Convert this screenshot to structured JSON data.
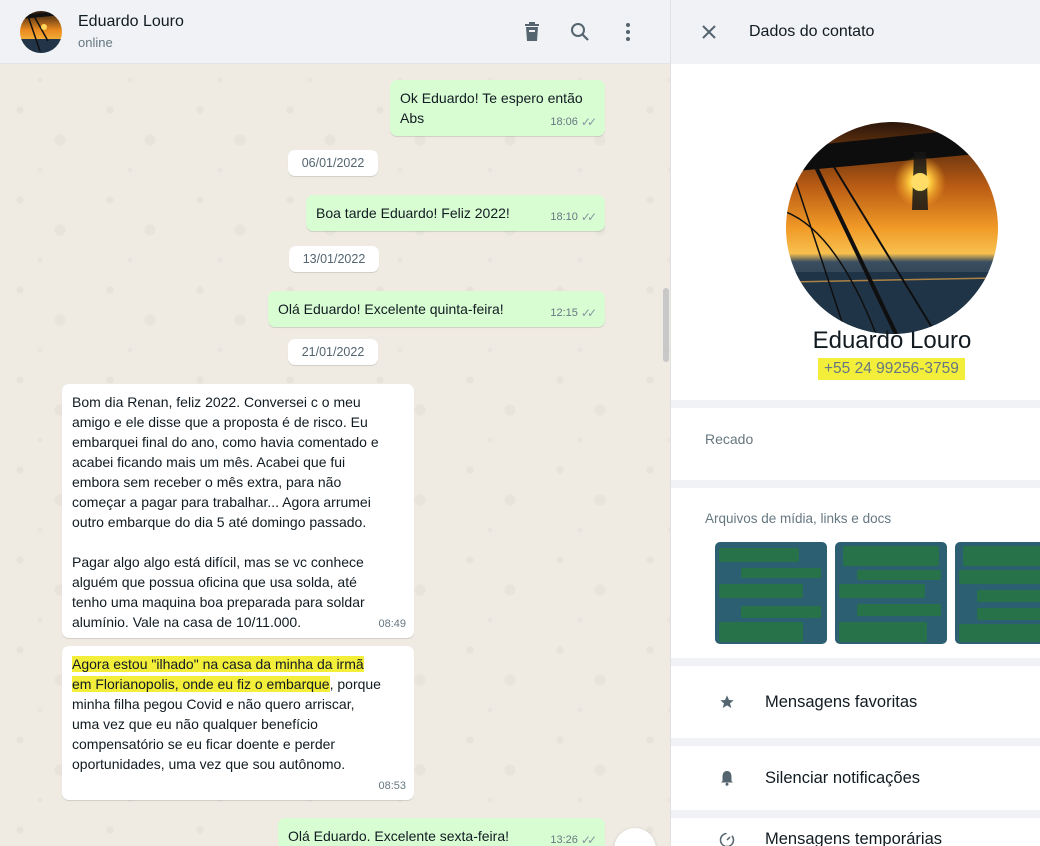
{
  "colors": {
    "outgoing": "#d9fdd3",
    "incoming": "#ffffff",
    "highlight": "#f3ee3a",
    "header": "#f0f2f5"
  },
  "chat": {
    "contact_name": "Eduardo Louro",
    "status": "online",
    "icons": [
      "trash-icon",
      "search-icon",
      "menu-icon"
    ],
    "messages": [
      {
        "type": "out",
        "text": "Ok Eduardo! Te espero então\nAbs",
        "time": "18:06"
      },
      {
        "type": "date",
        "text": "06/01/2022"
      },
      {
        "type": "out",
        "text": "Boa tarde Eduardo! Feliz 2022!",
        "time": "18:10"
      },
      {
        "type": "date",
        "text": "13/01/2022"
      },
      {
        "type": "out",
        "text": "Olá Eduardo! Excelente quinta-feira!",
        "time": "12:15"
      },
      {
        "type": "date",
        "text": "21/01/2022"
      },
      {
        "type": "in",
        "text": "Bom dia Renan, feliz 2022. Conversei c o meu\namigo e ele disse que a proposta é de risco. Eu\nembarquei final do ano, como havia comentado e\nacabei ficando mais um mês.  Acabei que fui\nembora sem receber o mês extra, para não\ncomeçar a pagar para trabalhar... Agora arrumei\noutro embarque do dia 5 até domingo passado.\n\nPagar algo algo está difícil, mas se vc conhece\nalguém que possua oficina que usa solda, até\ntenho uma maquina boa preparada para soldar\nalumínio. Vale na casa de 10/11.000.",
        "time": "08:49"
      },
      {
        "type": "in",
        "text_highlight_1": "Agora estou \"ilhado\" na casa da minha da irmã",
        "text_highlight_2": "em Florianopolis, onde eu fiz o embarque",
        "text_rest_1": ", porque",
        "text_rest": "minha filha pegou Covid e não quero arriscar,\numa vez que eu não qualquer benefício\ncompensatório se eu ficar doente e perder\noportunidades, uma vez que sou autônomo.",
        "time": "08:53"
      },
      {
        "type": "out",
        "text": "Olá Eduardo. Excelente sexta-feira!",
        "time": "13:26"
      }
    ]
  },
  "panel": {
    "title": "Dados do contato",
    "name": "Eduardo Louro",
    "phone": "+55 24 99256-3759",
    "about_label": "Recado",
    "media_label": "Arquivos de mídia, links e docs",
    "rows": [
      {
        "label": "Mensagens favoritas",
        "icon": "star-icon"
      },
      {
        "label": "Silenciar notificações",
        "icon": "bell-icon"
      },
      {
        "label": "Mensagens temporárias",
        "icon": "timer-icon"
      }
    ]
  }
}
